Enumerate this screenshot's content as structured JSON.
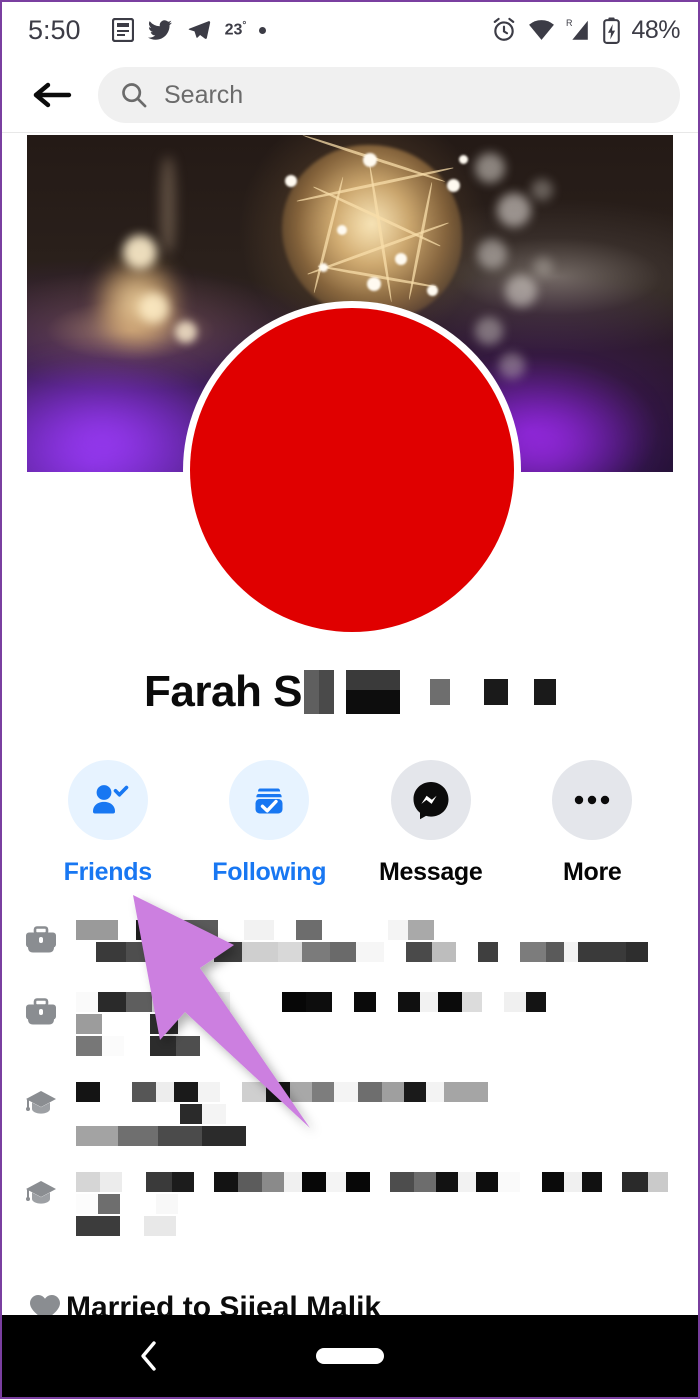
{
  "status_bar": {
    "time": "5:50",
    "temperature": "23",
    "degree_symbol": "°",
    "battery_percent": "48%",
    "icons": [
      "news-article-icon",
      "twitter-bird-icon",
      "telegram-send-icon",
      "weather-dot-icon",
      "alarm-clock-icon",
      "wifi-icon",
      "roaming-signal-icon",
      "battery-charging-icon"
    ],
    "roaming_label": "R"
  },
  "header": {
    "back_icon": "back-arrow-icon",
    "search_icon": "search-icon",
    "search_placeholder": "Search",
    "search_value": ""
  },
  "cover": {
    "description": "fairy-lights-bokeh-cover-photo"
  },
  "profile": {
    "name_visible": "Farah S",
    "name_redacted": true,
    "avatar_color": "#e00000",
    "avatar_redacted": true
  },
  "actions": [
    {
      "label": "Friends",
      "icon": "friend-check-icon",
      "circle_color": "#e7f3ff",
      "label_color": "#1877f2",
      "state": "active"
    },
    {
      "label": "Following",
      "icon": "following-check-icon",
      "circle_color": "#e7f3ff",
      "label_color": "#1877f2",
      "state": "active"
    },
    {
      "label": "Message",
      "icon": "messenger-icon",
      "circle_color": "#e4e6eb",
      "label_color": "#050505",
      "state": "default"
    },
    {
      "label": "More",
      "icon": "more-dots-icon",
      "circle_color": "#e4e6eb",
      "label_color": "#050505",
      "state": "default"
    }
  ],
  "info_rows": [
    {
      "icon": "briefcase-icon",
      "text": "",
      "redacted": true,
      "lines": 2
    },
    {
      "icon": "briefcase-icon",
      "text": "",
      "redacted": true,
      "lines": 3
    },
    {
      "icon": "graduation-cap-icon",
      "text": "",
      "redacted": true,
      "lines": 2
    },
    {
      "icon": "graduation-cap-icon",
      "text": "",
      "redacted": true,
      "lines": 2
    },
    {
      "icon": "heart-icon",
      "text": "Married to Sijeal Malik",
      "redacted": false,
      "lines": 1
    }
  ],
  "annotation": {
    "type": "arrow",
    "color": "#cc7fe0",
    "points_to": "Friends"
  },
  "nav_bar": {
    "back_icon": "nav-back-chevron-icon",
    "home_icon": "nav-home-pill-icon",
    "background": "#000000"
  }
}
